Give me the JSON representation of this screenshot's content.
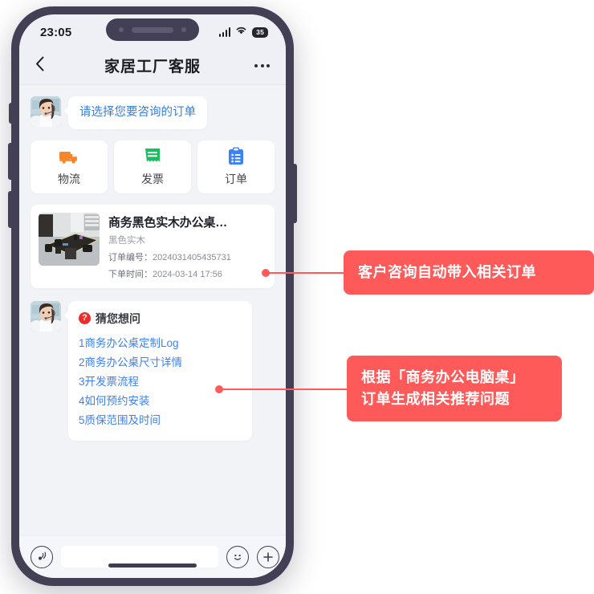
{
  "status_bar": {
    "time": "23:05",
    "battery_level": "35",
    "signal_icon": "signal-bars-icon",
    "wifi_icon": "wifi-icon",
    "battery_icon": "battery-icon"
  },
  "nav": {
    "back_icon": "chevron-left-icon",
    "title": "家居工厂客服",
    "more_icon": "more-dots-icon"
  },
  "chat": {
    "agent_avatar_alt": "customer-service-agent-avatar",
    "greeting": "请选择您要咨询的订单",
    "quick_actions": [
      {
        "label": "物流",
        "icon": "truck-icon",
        "color": "#f5862e"
      },
      {
        "label": "发票",
        "icon": "receipt-icon",
        "color": "#18bf5c"
      },
      {
        "label": "订单",
        "icon": "clipboard-icon",
        "color": "#3b82f6"
      }
    ],
    "order_card": {
      "thumb_alt": "office-desk-product-image",
      "title": "商务黑色实木办公桌…",
      "spec": "黑色实木",
      "order_no_label": "订单编号：",
      "order_no_value": "2024031405435731",
      "order_time_label": "下单时间：",
      "order_time_value": "2024-03-14 17:56"
    },
    "guess": {
      "badge_icon": "question-mark-icon",
      "badge_glyph": "?",
      "title": "猜您想问",
      "items": [
        "1商务办公桌定制Log",
        "2商务办公桌尺寸详情",
        "3开发票流程",
        "4如何预约安装",
        "5质保范围及时间"
      ]
    }
  },
  "input_bar": {
    "voice_icon": "voice-wave-icon",
    "input_value": "",
    "input_placeholder": "",
    "emoji_icon": "smiley-icon",
    "plus_icon": "plus-circle-icon"
  },
  "annotations": [
    {
      "text": "客户咨询自动带入相关订单"
    },
    {
      "text": "根据「商务办公电脑桌」\n订单生成相关推荐问题"
    }
  ],
  "colors": {
    "accent_red": "#ff5a5a",
    "link_blue": "#3b82f6",
    "frame": "#433f55"
  }
}
